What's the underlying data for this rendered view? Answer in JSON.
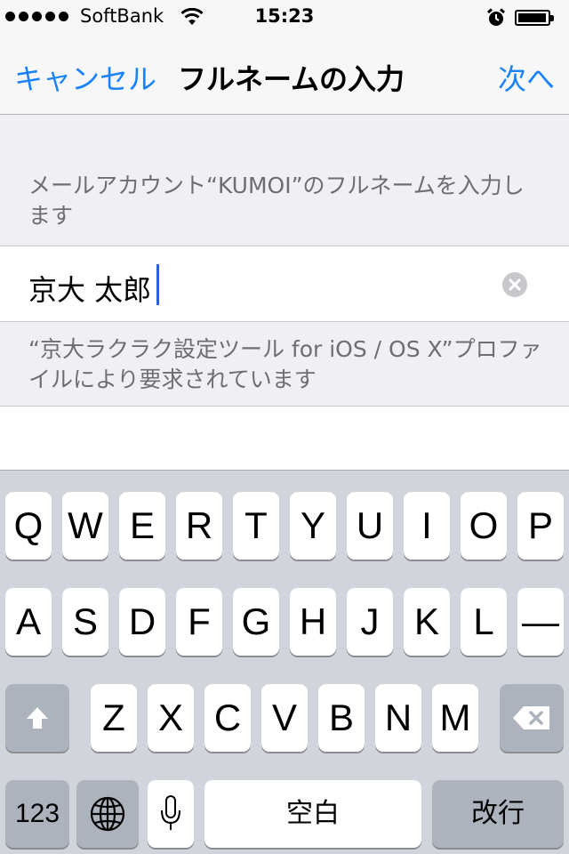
{
  "status_bar": {
    "carrier": "SoftBank",
    "time": "15:23",
    "signal_bars": 5,
    "battery_percent": 90
  },
  "nav": {
    "cancel": "キャンセル",
    "title": "フルネームの入力",
    "next": "次へ"
  },
  "form": {
    "header": "メールアカウント“KUMOI”のフルネームを入力します",
    "value": "京大 太郎",
    "footer": "“京大ラクラク設定ツール for iOS / OS X”プロファイルにより要求されています"
  },
  "keyboard": {
    "row1": [
      "Q",
      "W",
      "E",
      "R",
      "T",
      "Y",
      "U",
      "I",
      "O",
      "P"
    ],
    "row2": [
      "A",
      "S",
      "D",
      "F",
      "G",
      "H",
      "J",
      "K",
      "L",
      "—"
    ],
    "row3": [
      "Z",
      "X",
      "C",
      "V",
      "B",
      "N",
      "M"
    ],
    "numbers": "123",
    "space": "空白",
    "return": "改行"
  }
}
